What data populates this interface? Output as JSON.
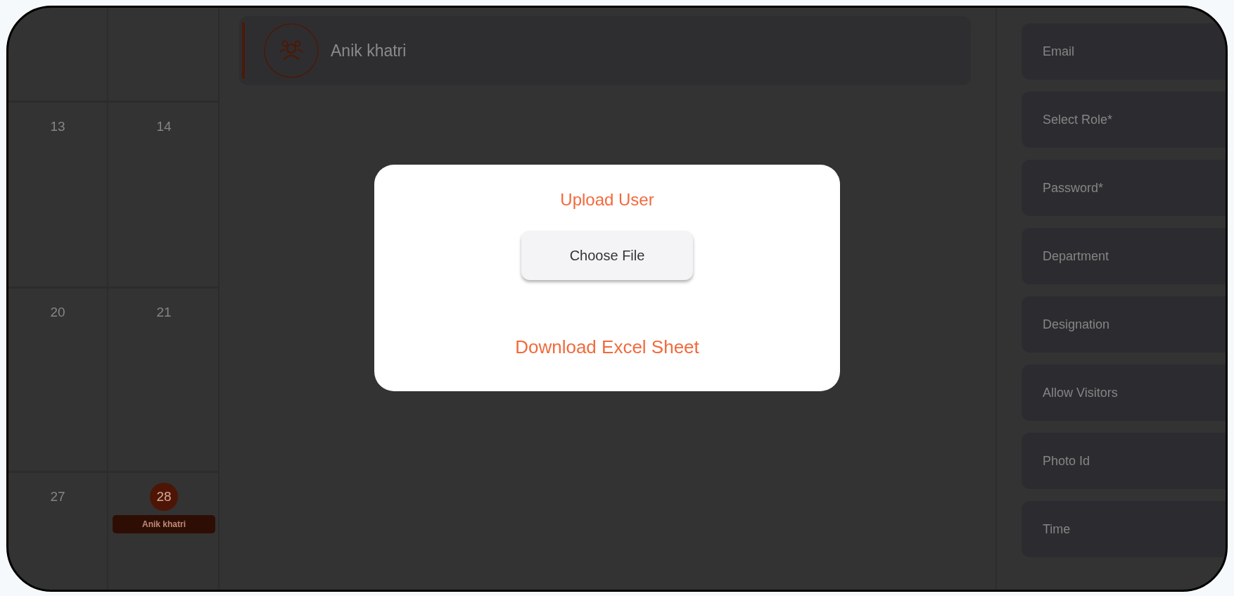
{
  "calendar": {
    "cells": [
      {
        "day": "13",
        "today": false
      },
      {
        "day": "14",
        "today": false
      },
      {
        "day": "20",
        "today": false
      },
      {
        "day": "21",
        "today": false
      },
      {
        "day": "27",
        "today": false
      },
      {
        "day": "28",
        "today": true,
        "events": [
          "Anik khatri"
        ]
      }
    ]
  },
  "user_card": {
    "name": "Anik khatri"
  },
  "form_fields": [
    {
      "placeholder": "Email"
    },
    {
      "placeholder": "Select Role*"
    },
    {
      "placeholder": "Password*"
    },
    {
      "placeholder": "Department"
    },
    {
      "placeholder": "Designation"
    },
    {
      "placeholder": "Allow Visitors"
    },
    {
      "placeholder": "Photo Id"
    },
    {
      "placeholder": "Time"
    }
  ],
  "modal": {
    "title": "Upload User",
    "choose_button": "Choose File",
    "download_link": "Download Excel Sheet"
  }
}
